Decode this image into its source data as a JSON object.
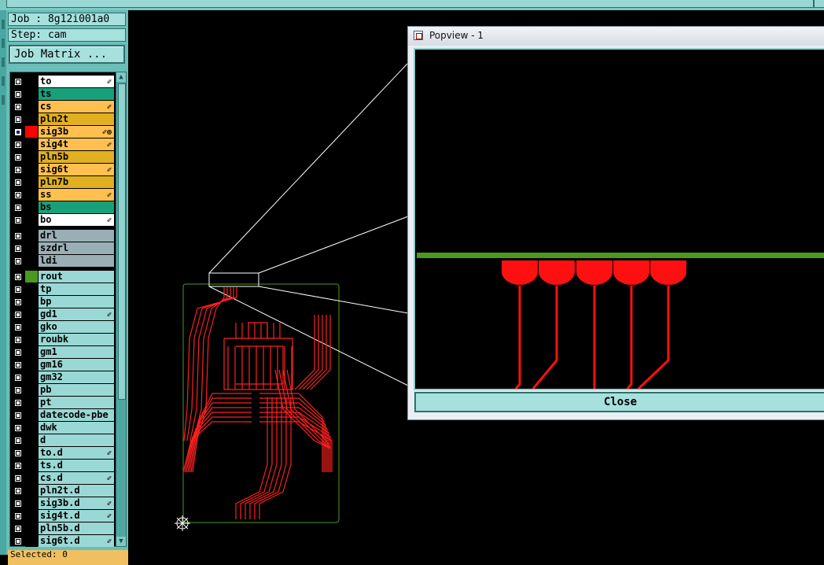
{
  "job": {
    "label": "Job : 8g12i001a0"
  },
  "step": {
    "label": "Step: cam"
  },
  "job_matrix_button": "Job Matrix ...",
  "colors": {
    "top": "#ffffff",
    "teal_mask": "#18a07a",
    "orange": "#ffc050",
    "gold": "#e0b020",
    "grey": "#9aaeb5",
    "cyan": "#9ad8d5",
    "trace_red": "#ff0000",
    "rout_green": "#4a9a20"
  },
  "layers_group1": [
    {
      "name": "to",
      "color": "#ffffff",
      "icon": "✐",
      "selected": false
    },
    {
      "name": "ts",
      "color": "#18a07a",
      "icon": "",
      "selected": false
    },
    {
      "name": "cs",
      "color": "#ffc050",
      "icon": "✐",
      "selected": false
    },
    {
      "name": "pln2t",
      "color": "#e0b020",
      "icon": "",
      "selected": false
    },
    {
      "name": "sig3b",
      "color": "#ffc050",
      "icon": "✐⊕",
      "selected": true,
      "swatch": "#ff0000"
    },
    {
      "name": "sig4t",
      "color": "#ffc050",
      "icon": "✐",
      "selected": false
    },
    {
      "name": "pln5b",
      "color": "#e0b020",
      "icon": "",
      "selected": false
    },
    {
      "name": "sig6t",
      "color": "#ffc050",
      "icon": "✐",
      "selected": false
    },
    {
      "name": "pln7b",
      "color": "#e0b020",
      "icon": "",
      "selected": false
    },
    {
      "name": "ss",
      "color": "#ffc050",
      "icon": "✐",
      "selected": false
    },
    {
      "name": "bs",
      "color": "#18a07a",
      "icon": "",
      "selected": false
    },
    {
      "name": "bo",
      "color": "#ffffff",
      "icon": "✐",
      "selected": false
    }
  ],
  "layers_group2": [
    {
      "name": "drl",
      "color": "#9aaeb5"
    },
    {
      "name": "szdrl",
      "color": "#9aaeb5"
    },
    {
      "name": "ldi",
      "color": "#9aaeb5"
    }
  ],
  "layers_group3": [
    {
      "name": "rout",
      "icon": "",
      "swatch": "#4a9a20"
    },
    {
      "name": "tp",
      "icon": ""
    },
    {
      "name": "bp",
      "icon": ""
    },
    {
      "name": "gd1",
      "icon": "✐"
    },
    {
      "name": "gko",
      "icon": ""
    },
    {
      "name": "roubk",
      "icon": ""
    },
    {
      "name": "gm1",
      "icon": ""
    },
    {
      "name": "gm16",
      "icon": ""
    },
    {
      "name": "gm32",
      "icon": ""
    },
    {
      "name": "pb",
      "icon": ""
    },
    {
      "name": "pt",
      "icon": ""
    },
    {
      "name": "datecode-pbe",
      "icon": ""
    },
    {
      "name": "dwk",
      "icon": ""
    },
    {
      "name": "d",
      "icon": ""
    },
    {
      "name": "to.d",
      "icon": "✐"
    },
    {
      "name": "ts.d",
      "icon": ""
    },
    {
      "name": "cs.d",
      "icon": "✐"
    },
    {
      "name": "pln2t.d",
      "icon": ""
    },
    {
      "name": "sig3b.d",
      "icon": "✐"
    },
    {
      "name": "sig4t.d",
      "icon": "✐"
    },
    {
      "name": "pln5b.d",
      "icon": ""
    },
    {
      "name": "sig6t.d",
      "icon": "✐"
    }
  ],
  "bottom_strip": "Selected: 0",
  "popup": {
    "title": "Popview - 1",
    "close_label": "Close"
  }
}
